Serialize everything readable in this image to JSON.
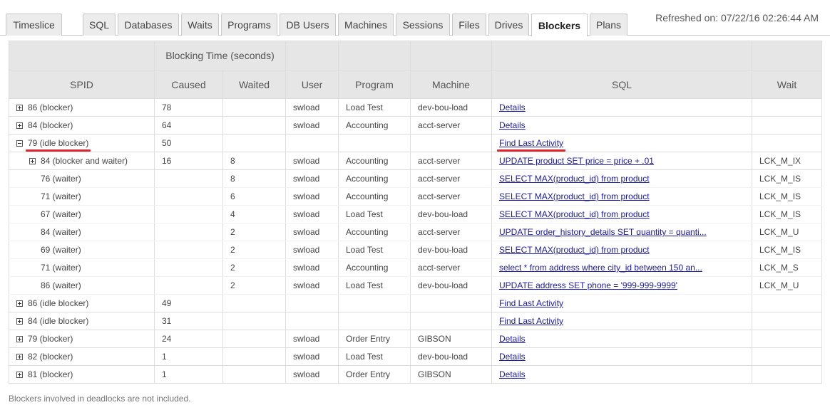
{
  "tabs": [
    {
      "label": "Timeslice",
      "active": false
    },
    {
      "label": "SQL",
      "active": false
    },
    {
      "label": "Databases",
      "active": false
    },
    {
      "label": "Waits",
      "active": false
    },
    {
      "label": "Programs",
      "active": false
    },
    {
      "label": "DB Users",
      "active": false
    },
    {
      "label": "Machines",
      "active": false
    },
    {
      "label": "Sessions",
      "active": false
    },
    {
      "label": "Files",
      "active": false
    },
    {
      "label": "Drives",
      "active": false
    },
    {
      "label": "Blockers",
      "active": true
    },
    {
      "label": "Plans",
      "active": false
    }
  ],
  "refreshed": "Refreshed on: 07/22/16 02:26:44 AM",
  "table": {
    "group_header": "Blocking Time (seconds)",
    "columns": [
      "SPID",
      "Caused",
      "Waited",
      "User",
      "Program",
      "Machine",
      "SQL",
      "Wait"
    ],
    "rows": [
      {
        "spid": "86 (blocker)",
        "expander": "plus",
        "indent": 0,
        "caused": "78",
        "waited": "",
        "user": "swload",
        "program": "Load Test",
        "machine": "dev-bou-load",
        "sql": "Details",
        "wait": ""
      },
      {
        "spid": "84 (blocker)",
        "expander": "plus",
        "indent": 0,
        "caused": "64",
        "waited": "",
        "user": "swload",
        "program": "Accounting",
        "machine": "acct-server",
        "sql": "Details",
        "wait": ""
      },
      {
        "spid": "79 (idle blocker)",
        "expander": "minus",
        "indent": 0,
        "caused": "50",
        "waited": "",
        "user": "",
        "program": "",
        "machine": "",
        "sql": "Find Last Activity",
        "wait": ""
      },
      {
        "spid": "84 (blocker and waiter)",
        "expander": "plus",
        "indent": 1,
        "caused": "16",
        "waited": "8",
        "user": "swload",
        "program": "Accounting",
        "machine": "acct-server",
        "sql": "UPDATE product SET price = price + .01",
        "wait": "LCK_M_IX"
      },
      {
        "spid": "76 (waiter)",
        "expander": "",
        "indent": 2,
        "caused": "",
        "waited": "8",
        "user": "swload",
        "program": "Accounting",
        "machine": "acct-server",
        "sql": "SELECT MAX(product_id) from product",
        "wait": "LCK_M_IS"
      },
      {
        "spid": "71 (waiter)",
        "expander": "",
        "indent": 2,
        "caused": "",
        "waited": "6",
        "user": "swload",
        "program": "Accounting",
        "machine": "acct-server",
        "sql": "SELECT MAX(product_id) from product",
        "wait": "LCK_M_IS"
      },
      {
        "spid": "67 (waiter)",
        "expander": "",
        "indent": 2,
        "caused": "",
        "waited": "4",
        "user": "swload",
        "program": "Load Test",
        "machine": "dev-bou-load",
        "sql": "SELECT MAX(product_id) from product",
        "wait": "LCK_M_IS"
      },
      {
        "spid": "84 (waiter)",
        "expander": "",
        "indent": 2,
        "caused": "",
        "waited": "2",
        "user": "swload",
        "program": "Accounting",
        "machine": "acct-server",
        "sql": "UPDATE order_history_details SET quantity = quanti...",
        "wait": "LCK_M_U"
      },
      {
        "spid": "69 (waiter)",
        "expander": "",
        "indent": 2,
        "caused": "",
        "waited": "2",
        "user": "swload",
        "program": "Load Test",
        "machine": "dev-bou-load",
        "sql": "SELECT MAX(product_id) from product",
        "wait": "LCK_M_IS"
      },
      {
        "spid": "71 (waiter)",
        "expander": "",
        "indent": 2,
        "caused": "",
        "waited": "2",
        "user": "swload",
        "program": "Accounting",
        "machine": "acct-server",
        "sql": "select * from address where city_id between 150 an...",
        "wait": "LCK_M_S"
      },
      {
        "spid": "86 (waiter)",
        "expander": "",
        "indent": 2,
        "caused": "",
        "waited": "2",
        "user": "swload",
        "program": "Load Test",
        "machine": "dev-bou-load",
        "sql": "UPDATE address SET phone = '999-999-9999'",
        "wait": "LCK_M_U"
      },
      {
        "spid": "86 (idle blocker)",
        "expander": "plus",
        "indent": 0,
        "caused": "49",
        "waited": "",
        "user": "",
        "program": "",
        "machine": "",
        "sql": "Find Last Activity",
        "wait": ""
      },
      {
        "spid": "84 (idle blocker)",
        "expander": "plus",
        "indent": 0,
        "caused": "31",
        "waited": "",
        "user": "",
        "program": "",
        "machine": "",
        "sql": "Find Last Activity",
        "wait": ""
      },
      {
        "spid": "79 (blocker)",
        "expander": "plus",
        "indent": 0,
        "caused": "24",
        "waited": "",
        "user": "swload",
        "program": "Order Entry",
        "machine": "GIBSON",
        "sql": "Details",
        "wait": ""
      },
      {
        "spid": "82 (blocker)",
        "expander": "plus",
        "indent": 0,
        "caused": "1",
        "waited": "",
        "user": "swload",
        "program": "Load Test",
        "machine": "dev-bou-load",
        "sql": "Details",
        "wait": ""
      },
      {
        "spid": "81 (blocker)",
        "expander": "plus",
        "indent": 0,
        "caused": "1",
        "waited": "",
        "user": "swload",
        "program": "Order Entry",
        "machine": "GIBSON",
        "sql": "Details",
        "wait": ""
      }
    ]
  },
  "footer": "Blockers involved in deadlocks are not included.",
  "colors": {
    "link": "#1a1aa8",
    "highlight": "#d9282f",
    "header_bg": "#e6e6e6"
  }
}
